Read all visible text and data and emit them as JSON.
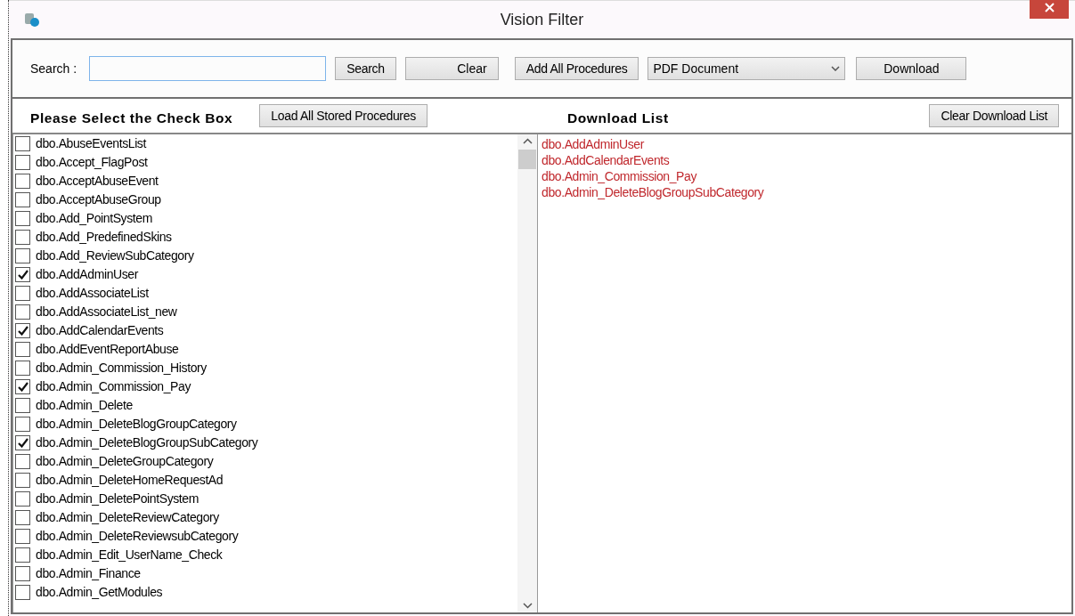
{
  "window": {
    "title": "Vision Filter"
  },
  "search": {
    "label": "Search :"
  },
  "toolbar": {
    "search_button": "Search",
    "clear_button": "Clear",
    "add_all_button": "Add All Procedures",
    "format_select": "PDF Document",
    "download_button": "Download"
  },
  "left_panel": {
    "heading": "Please Select the Check Box",
    "load_button": "Load All Stored Procedures",
    "items": [
      {
        "label": "dbo.AbuseEventsList",
        "checked": false
      },
      {
        "label": "dbo.Accept_FlagPost",
        "checked": false
      },
      {
        "label": "dbo.AcceptAbuseEvent",
        "checked": false
      },
      {
        "label": "dbo.AcceptAbuseGroup",
        "checked": false
      },
      {
        "label": "dbo.Add_PointSystem",
        "checked": false
      },
      {
        "label": "dbo.Add_PredefinedSkins",
        "checked": false
      },
      {
        "label": "dbo.Add_ReviewSubCategory",
        "checked": false
      },
      {
        "label": "dbo.AddAdminUser",
        "checked": true
      },
      {
        "label": "dbo.AddAssociateList",
        "checked": false
      },
      {
        "label": "dbo.AddAssociateList_new",
        "checked": false
      },
      {
        "label": "dbo.AddCalendarEvents",
        "checked": true
      },
      {
        "label": "dbo.AddEventReportAbuse",
        "checked": false
      },
      {
        "label": "dbo.Admin_Commission_History",
        "checked": false
      },
      {
        "label": "dbo.Admin_Commission_Pay",
        "checked": true
      },
      {
        "label": "dbo.Admin_Delete",
        "checked": false
      },
      {
        "label": "dbo.Admin_DeleteBlogGroupCategory",
        "checked": false
      },
      {
        "label": "dbo.Admin_DeleteBlogGroupSubCategory",
        "checked": true
      },
      {
        "label": "dbo.Admin_DeleteGroupCategory",
        "checked": false
      },
      {
        "label": "dbo.Admin_DeleteHomeRequestAd",
        "checked": false
      },
      {
        "label": "dbo.Admin_DeletePointSystem",
        "checked": false
      },
      {
        "label": "dbo.Admin_DeleteReviewCategory",
        "checked": false
      },
      {
        "label": "dbo.Admin_DeleteReviewsubCategory",
        "checked": false
      },
      {
        "label": "dbo.Admin_Edit_UserName_Check",
        "checked": false
      },
      {
        "label": "dbo.Admin_Finance",
        "checked": false
      },
      {
        "label": "dbo.Admin_GetModules",
        "checked": false
      }
    ]
  },
  "right_panel": {
    "heading": "Download List",
    "clear_button": "Clear Download List",
    "items": [
      "dbo.AddAdminUser",
      "dbo.AddCalendarEvents",
      "dbo.Admin_Commission_Pay",
      "dbo.Admin_DeleteBlogGroupSubCategory"
    ]
  }
}
